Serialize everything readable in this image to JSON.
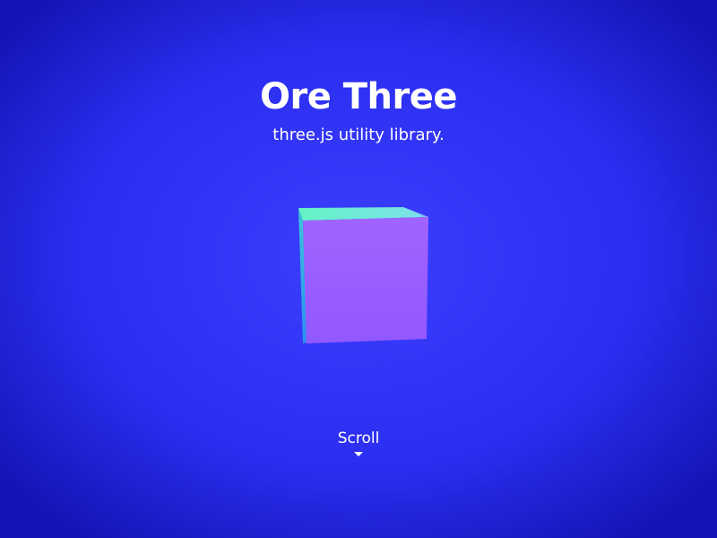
{
  "hero": {
    "title": "Ore Three",
    "subtitle": "three.js utility library.",
    "scroll_label": "Scroll"
  },
  "colors": {
    "background_center": "#3a3dfb",
    "background_edge": "#1212b6",
    "text": "#ffffff",
    "cube_front": "#9b5cff",
    "cube_top": "#5ef0c9",
    "cube_side": "#22a6ef"
  },
  "icons": {
    "scroll_arrow": "caret-down-icon"
  }
}
